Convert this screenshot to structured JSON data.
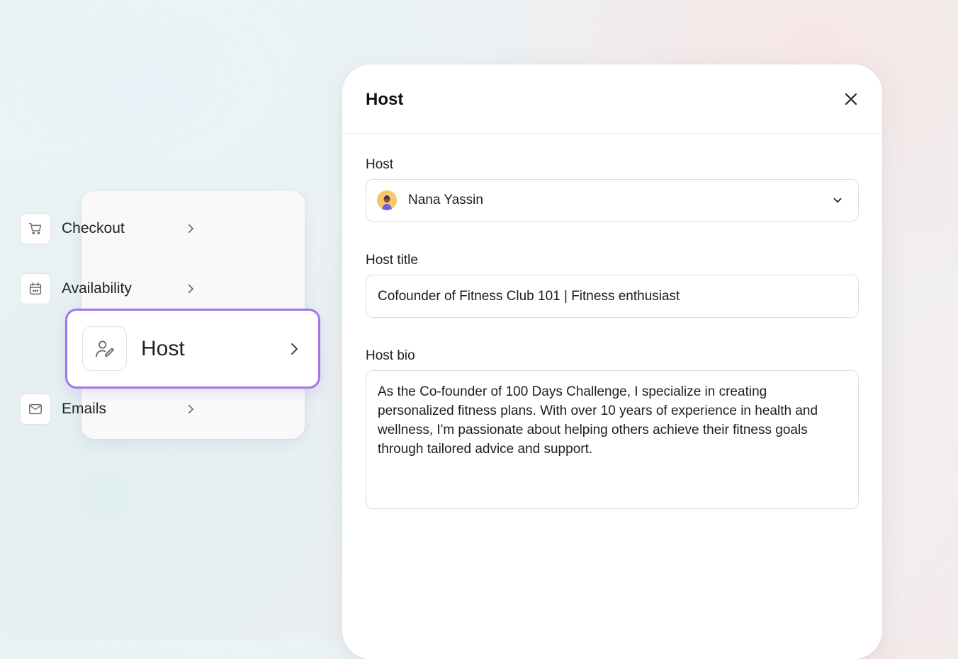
{
  "menu": {
    "items": [
      {
        "label": "Checkout",
        "icon": "cart-icon"
      },
      {
        "label": "Availability",
        "icon": "calendar-icon"
      },
      {
        "label": "Host",
        "icon": "user-edit-icon",
        "active": true
      },
      {
        "label": "Emails",
        "icon": "mail-icon"
      }
    ]
  },
  "panel": {
    "title": "Host",
    "host": {
      "label": "Host",
      "value": "Nana Yassin"
    },
    "host_title": {
      "label": "Host title",
      "value": "Cofounder of Fitness Club 101 | Fitness enthusiast"
    },
    "host_bio": {
      "label": "Host bio",
      "value": "As the Co-founder of 100 Days Challenge, I specialize in creating personalized fitness plans. With over 10 years of experience in health and wellness, I'm passionate about helping others achieve their fitness goals through tailored advice and support."
    }
  },
  "colors": {
    "accent": "#a076ea",
    "avatar_bg": "#f5c768"
  }
}
